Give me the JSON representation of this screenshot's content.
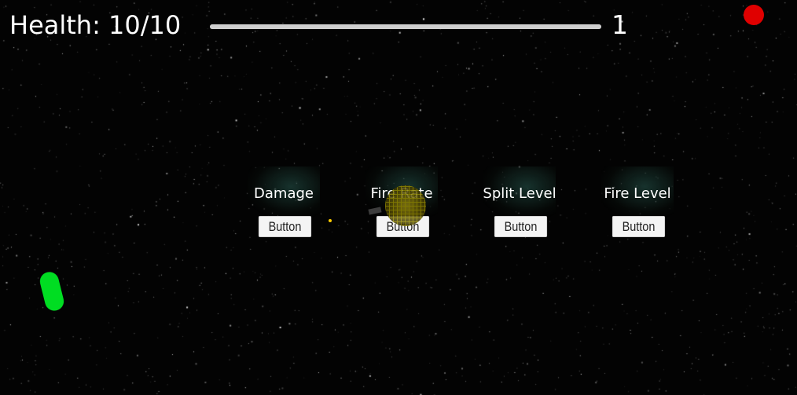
{
  "hud": {
    "health_text": "Health: 10/10",
    "level_value": "1",
    "progress_fraction": 1.0
  },
  "upgrades": [
    {
      "title": "Damage",
      "button_label": "Button"
    },
    {
      "title": "Fire Rate",
      "button_label": "Button"
    },
    {
      "title": "Split Level",
      "button_label": "Button"
    },
    {
      "title": "Fire Level",
      "button_label": "Button"
    }
  ],
  "colors": {
    "background": "#030303",
    "player": "#00dd22",
    "record_indicator": "#e00000",
    "enemy": "#8a7d10"
  },
  "icons": {
    "record_indicator": "red-circle-icon",
    "player": "green-capsule-ship",
    "enemy": "yellow-wireframe-sphere"
  }
}
